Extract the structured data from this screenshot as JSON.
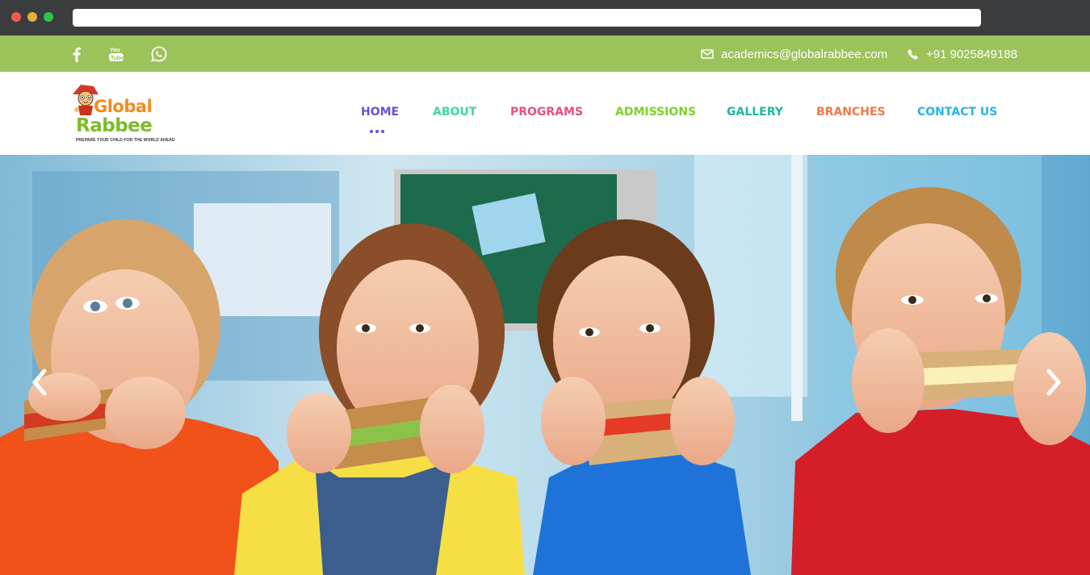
{
  "topbar": {
    "email": "academics@globalrabbee.com",
    "phone": "+91 9025849188"
  },
  "logo": {
    "line1": "Global",
    "line2": "Rabbee",
    "tagline": "PREPARE YOUR CHILD FOR THE WORLD AHEAD"
  },
  "nav": {
    "home": "HOME",
    "about": "ABOUT",
    "programs": "PROGRAMS",
    "admissions": "ADMISSIONS",
    "gallery": "GALLERY",
    "branches": "BRANCHES",
    "contact": "CONTACT US"
  },
  "colors": {
    "topbar": "#9bc35a",
    "home": "#6a4fd6",
    "about": "#3fd79a",
    "programs": "#e3527a",
    "admissions": "#7bd12c",
    "gallery": "#1fb89f",
    "branches": "#f0774a",
    "contact": "#27b3ea"
  },
  "icons": {
    "facebook": "facebook-icon",
    "youtube": "youtube-icon",
    "whatsapp": "whatsapp-icon",
    "email": "envelope-icon",
    "phone": "phone-icon",
    "prev": "chevron-left-icon",
    "next": "chevron-right-icon"
  }
}
